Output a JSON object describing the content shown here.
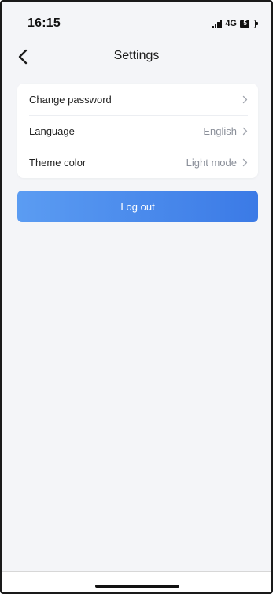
{
  "status_bar": {
    "time": "16:15",
    "network": "4G",
    "battery": "5"
  },
  "header": {
    "title": "Settings",
    "back_icon": "chevron-left-icon"
  },
  "settings": {
    "items": [
      {
        "label": "Change password",
        "value": "",
        "icon": "chevron-right-icon"
      },
      {
        "label": "Language",
        "value": "English",
        "icon": "chevron-right-icon"
      },
      {
        "label": "Theme color",
        "value": "Light mode",
        "icon": "chevron-right-icon"
      }
    ]
  },
  "actions": {
    "logout_label": "Log out"
  },
  "colors": {
    "page_background": "#f4f5f8",
    "card_background": "#ffffff",
    "accent_start": "#5b9cf2",
    "accent_end": "#3b7ae6",
    "secondary_text": "#8a8f99"
  }
}
